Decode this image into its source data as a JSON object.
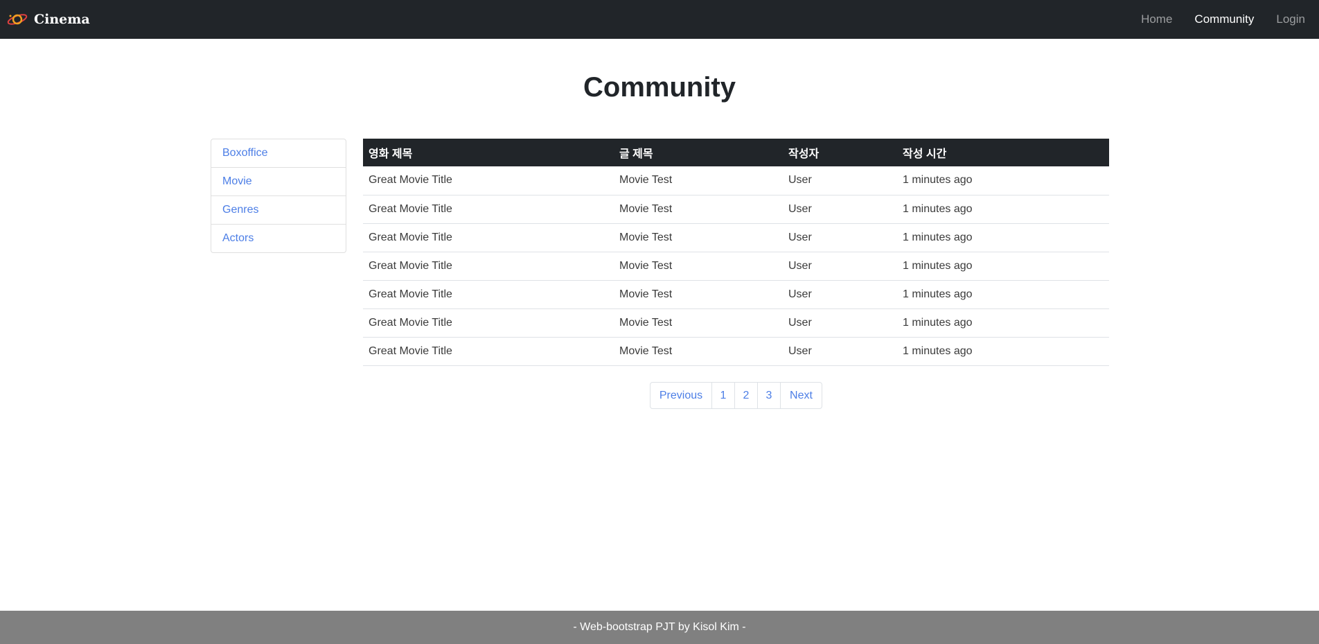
{
  "navbar": {
    "brand": "Cinema",
    "links": [
      {
        "label": "Home",
        "active": false
      },
      {
        "label": "Community",
        "active": true
      },
      {
        "label": "Login",
        "active": false
      }
    ]
  },
  "page": {
    "title": "Community"
  },
  "sidebar": {
    "items": [
      {
        "label": "Boxoffice"
      },
      {
        "label": "Movie"
      },
      {
        "label": "Genres"
      },
      {
        "label": "Actors"
      }
    ]
  },
  "table": {
    "headers": [
      "영화 제목",
      "글 제목",
      "작성자",
      "작성 시간"
    ],
    "rows": [
      [
        "Great Movie Title",
        "Movie Test",
        "User",
        "1 minutes ago"
      ],
      [
        "Great Movie Title",
        "Movie Test",
        "User",
        "1 minutes ago"
      ],
      [
        "Great Movie Title",
        "Movie Test",
        "User",
        "1 minutes ago"
      ],
      [
        "Great Movie Title",
        "Movie Test",
        "User",
        "1 minutes ago"
      ],
      [
        "Great Movie Title",
        "Movie Test",
        "User",
        "1 minutes ago"
      ],
      [
        "Great Movie Title",
        "Movie Test",
        "User",
        "1 minutes ago"
      ],
      [
        "Great Movie Title",
        "Movie Test",
        "User",
        "1 minutes ago"
      ]
    ]
  },
  "pagination": {
    "previous": "Previous",
    "pages": [
      "1",
      "2",
      "3"
    ],
    "next": "Next"
  },
  "footer": {
    "text": "- Web-bootstrap PJT by Kisol Kim -"
  },
  "colors": {
    "navbar_bg": "#212529",
    "link_blue": "#4c7ee6",
    "footer_bg": "#808080",
    "logo_orange": "#f0a020",
    "logo_red": "#e04040"
  }
}
